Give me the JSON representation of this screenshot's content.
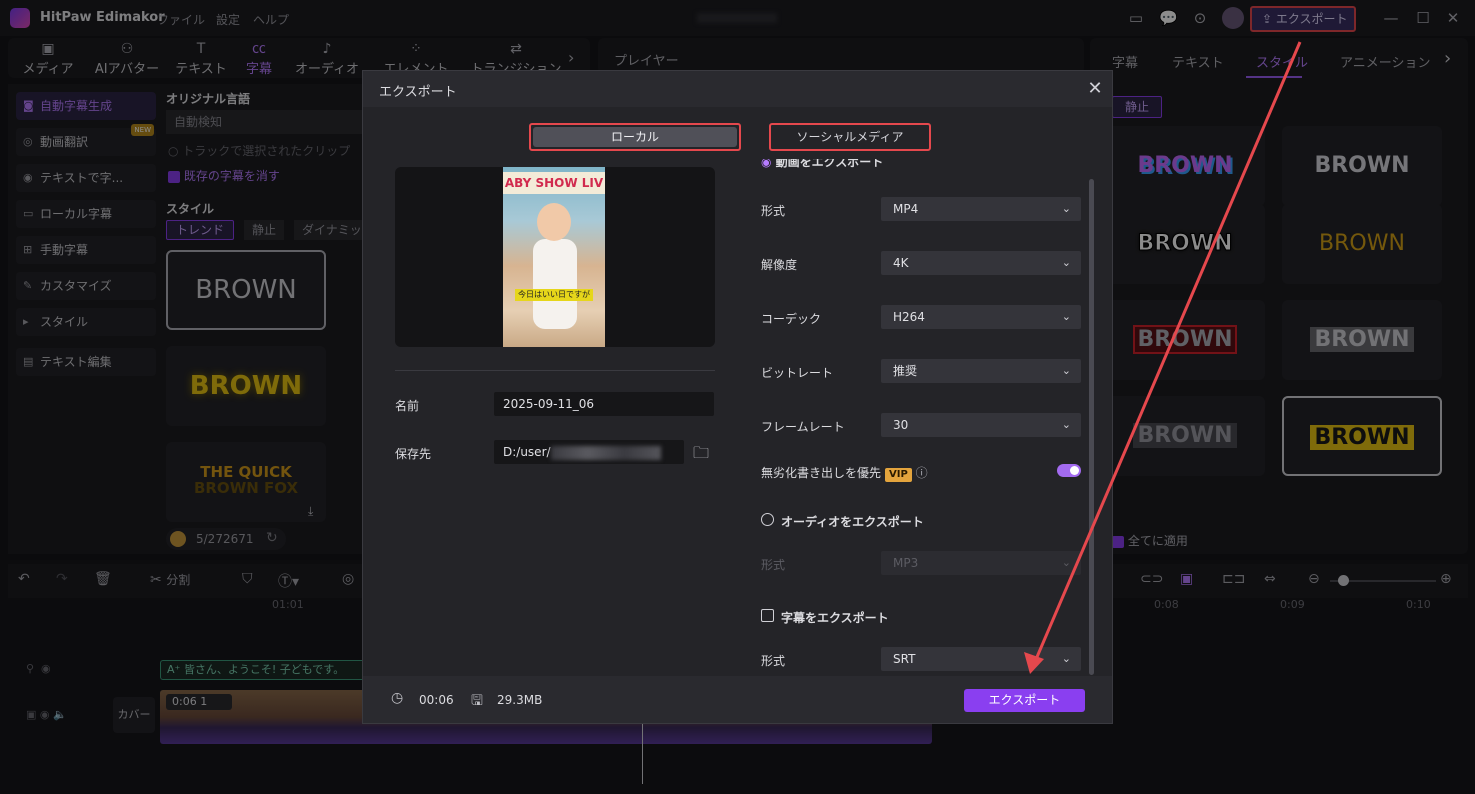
{
  "app": {
    "title": "HitPaw Edimakor",
    "menu": [
      "ファイル",
      "設定",
      "ヘルプ"
    ],
    "export_label": "エクスポート"
  },
  "tool_tabs": [
    {
      "label": "メディア",
      "icon": "media-icon"
    },
    {
      "label": "AIアバター",
      "icon": "avatar-icon"
    },
    {
      "label": "テキスト",
      "icon": "text-icon"
    },
    {
      "label": "字幕",
      "icon": "caption-icon"
    },
    {
      "label": "オーディオ",
      "icon": "music-icon"
    },
    {
      "label": "エレメント",
      "icon": "element-icon"
    },
    {
      "label": "トランジション",
      "icon": "transition-icon"
    }
  ],
  "sidebar": {
    "items": [
      {
        "label": "自動字幕生成",
        "new": ""
      },
      {
        "label": "動画翻訳",
        "new": "NEW"
      },
      {
        "label": "テキストで字...",
        "new": ""
      },
      {
        "label": "ローカル字幕",
        "new": ""
      },
      {
        "label": "手動字幕",
        "new": ""
      },
      {
        "label": "カスタマイズ",
        "new": ""
      },
      {
        "label": "スタイル",
        "new": ""
      },
      {
        "label": "テキスト編集",
        "new": ""
      }
    ]
  },
  "left_panel": {
    "lang_label": "オリジナル言語",
    "lang_value": "自動検知",
    "opt_track": "トラックで選択されたクリップ",
    "opt_clear": "既存の字幕を消す",
    "style_label": "スタイル",
    "style_tabs": [
      "トレンド",
      "静止",
      "ダイナミッ"
    ],
    "cards": [
      "BROWN",
      "BROWN",
      "THE QUICK",
      "BROWN FOX"
    ],
    "credits": "5/272671"
  },
  "player": {
    "title": "プレイヤー"
  },
  "right_panel": {
    "tabs": [
      "字幕",
      "テキスト",
      "スタイル",
      "アニメーション"
    ],
    "filter": "静止",
    "cards": [
      "BROWN",
      "BROWN",
      "BROWN",
      "BROWN",
      "BROWN",
      "BROWN",
      "BROWN",
      "BROWN"
    ],
    "apply_all": "全てに適用"
  },
  "timeline": {
    "split_label": "分割",
    "ticks": [
      "01:01",
      "0:08",
      "0:09",
      "0:10"
    ],
    "subtitle_clip": "A⁺ 皆さん、ようこそ! 子どもです。",
    "cover_label": "カバー",
    "clip_duration": "0:06 1"
  },
  "dialog": {
    "title": "エクスポート",
    "tab_local": "ローカル",
    "tab_social": "ソーシャルメディア",
    "preview_banner": "ABY SHOW LIV",
    "preview_subtitle": "今日はいい日ですが",
    "name_label": "名前",
    "name_value": "2025-09-11_06",
    "save_label": "保存先",
    "save_value": "D:/user/",
    "video_export": "動画をエクスポート",
    "format_label": "形式",
    "format_value": "MP4",
    "resolution_label": "解像度",
    "resolution_value": "4K",
    "codec_label": "コーデック",
    "codec_value": "H264",
    "bitrate_label": "ビットレート",
    "bitrate_value": "推奨",
    "framerate_label": "フレームレート",
    "framerate_value": "30",
    "lossless_label": "無劣化書き出しを優先",
    "vip": "VIP",
    "audio_export": "オーディオをエクスポート",
    "audio_format_label": "形式",
    "audio_format_value": "MP3",
    "subtitle_export": "字幕をエクスポート",
    "subtitle_format_label": "形式",
    "subtitle_format_value": "SRT",
    "duration": "00:06",
    "size": "29.3MB",
    "export_button": "エクスポート"
  },
  "colors": {
    "accent": "#8a3ff0",
    "highlight": "#e5484d"
  }
}
